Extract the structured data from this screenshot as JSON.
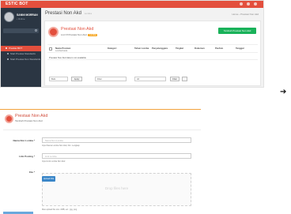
{
  "top_screenshot": {
    "sidebar": {
      "brand": "ESTIC BOT",
      "user_name": "SANNI MORRAN",
      "user_status": "• Online",
      "items": [
        {
          "label": "Prestas BOT"
        },
        {
          "label": "Start Prestas Standards"
        },
        {
          "label": "Start Prestas Non Standards"
        }
      ]
    },
    "page_title": "Prestasi Non Akd",
    "page_title_sub": "Lomba",
    "breadcrumb": "Home  ›  Prestasi Non Akd",
    "card": {
      "title": "Prestasi Non Akd",
      "subtitle": "List Of Prestasi Non Akd",
      "badge": "Lomba",
      "add_button": "Tambah Prestasi Non Akd"
    },
    "table": {
      "headers": [
        "Nama Prestasi",
        "Lomba/Juara",
        "Kategori",
        "Tahun Lomba",
        "Penyelenggara",
        "Tingkat",
        "Dokumen",
        "Pasfoto",
        "Waktu Lomba",
        "Tanggal"
      ],
      "subheaders": [
        "",
        "",
        "",
        "",
        "",
        "",
        "",
        "",
        "",
        ""
      ],
      "empty_message": "Prestasi Non Akd data is not available"
    },
    "bulk_bar": {
      "bulk_select": "Bulk",
      "apply_button": "Apply",
      "filter_input": "Filter",
      "filter_select": "All",
      "search_button": "Filter"
    }
  },
  "bottom_screenshot": {
    "title": "Prestasi Non Akd",
    "subtitle": "Tambah Prestasi Non Akd",
    "fields": [
      {
        "label": "Nama Non Lomba *",
        "placeholder": "Nama Non Lomba",
        "help": "Input Nama Lomba Non Akd, Nm. Lengkap"
      },
      {
        "label": "Link Posting *",
        "placeholder": "Link Lomba",
        "help": "Input Link Lomba Non Akd"
      },
      {
        "label": "File *",
        "upload_button": "Upload File",
        "dropzone_text": "Drop files here",
        "help": "Max upload file size: 2MB, ext : jpg, png"
      }
    ]
  },
  "arrow_glyph": "➔"
}
